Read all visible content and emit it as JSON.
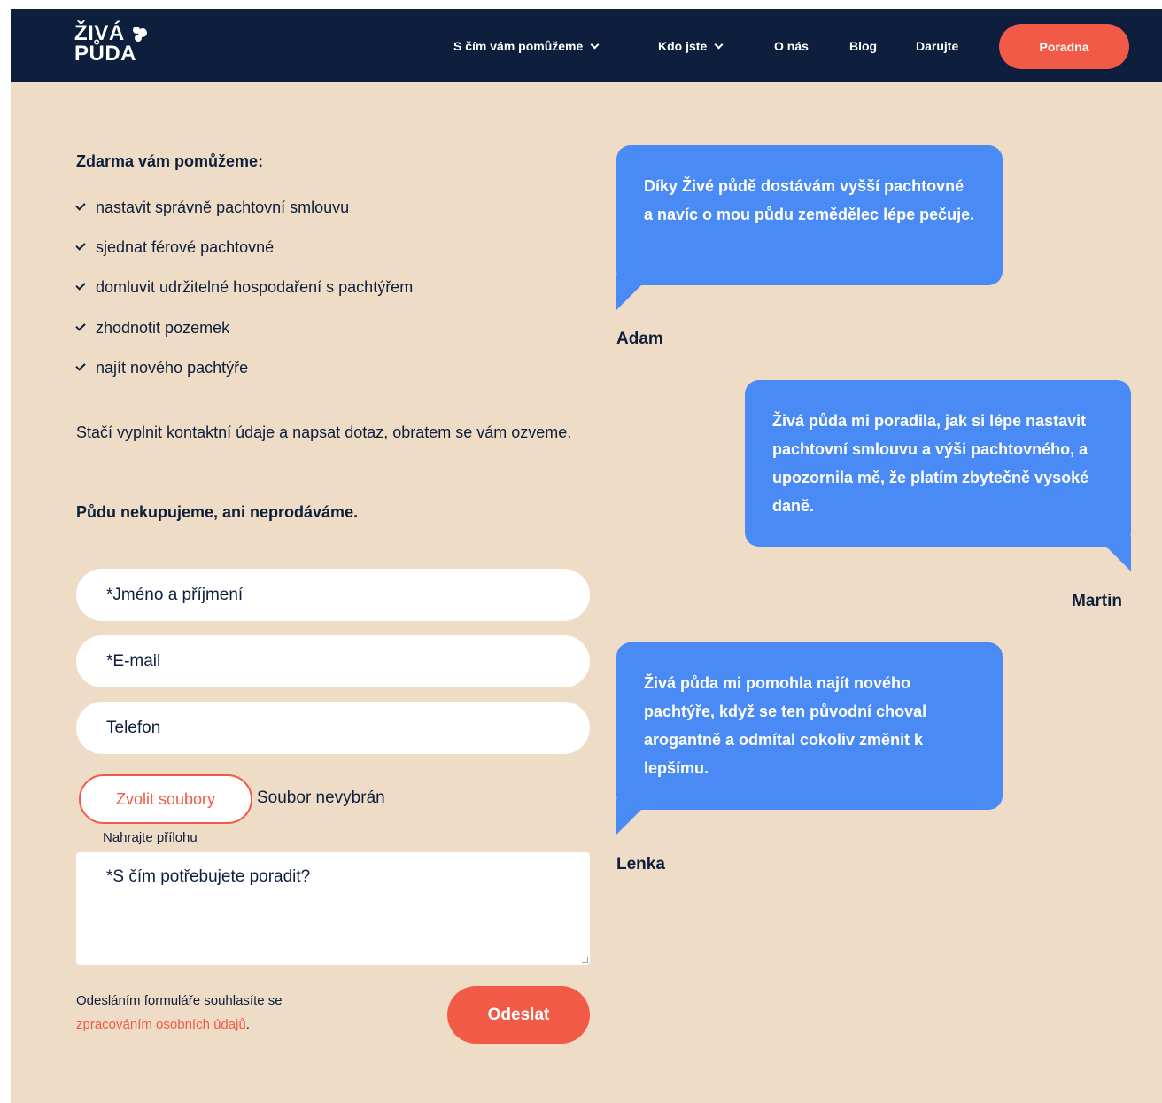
{
  "brand": {
    "logo_line1": "ŽIVÁ",
    "logo_line2": "PŮDA"
  },
  "nav": {
    "items": [
      {
        "label": "S čím vám pomůžeme",
        "has_dropdown": true
      },
      {
        "label": "Kdo jste",
        "has_dropdown": true
      },
      {
        "label": "O nás",
        "has_dropdown": false
      },
      {
        "label": "Blog",
        "has_dropdown": false
      },
      {
        "label": "Darujte",
        "has_dropdown": false
      }
    ],
    "cta_label": "Poradna"
  },
  "intro": {
    "heading": "Zdarma vám pomůžeme:",
    "checklist": [
      "nastavit správně pachtovní smlouvu",
      "sjednat férové pachtovné",
      "domluvit udržitelné hospodaření s pachtýřem",
      "zhodnotit pozemek",
      "najít nového pachtýře"
    ],
    "paragraph": "Stačí vyplnit kontaktní údaje a napsat dotaz, obratem se vám ozveme.",
    "notice": "Půdu nekupujeme, ani neprodáváme."
  },
  "form": {
    "name_placeholder": "*Jméno a příjmení",
    "email_placeholder": "*E-mail",
    "phone_placeholder": "Telefon",
    "file_button_label": "Zvolit soubory",
    "file_status": "Soubor nevybrán",
    "file_hint": "Nahrajte přílohu",
    "message_placeholder": "*S čím potřebujete poradit?",
    "consent_text": "Odesláním formuláře souhlasíte se",
    "consent_link": "zpracováním osobních údajů",
    "consent_end": ".",
    "submit_label": "Odeslat"
  },
  "testimonials": [
    {
      "quote": "Díky Živé půdě dostávám vyšší pachtovné a navíc o mou půdu zemědělec lépe pečuje.",
      "author": "Adam"
    },
    {
      "quote": "Živá půda mi poradila, jak si lépe nastavit pachtovní smlouvu a výši pachtovného, a upozornila mě, že platím zbytečně vysoké daně.",
      "author": "Martin"
    },
    {
      "quote": "Živá půda mi pomohla najít nového pachtýře, když se ten původní choval arogantně a odmítal cokoliv změnit k lepšímu.",
      "author": "Lenka"
    }
  ],
  "colors": {
    "navy": "#0d1f3c",
    "beige": "#eedcc6",
    "coral": "#f15a47",
    "bubble_blue": "#4a8af4"
  }
}
